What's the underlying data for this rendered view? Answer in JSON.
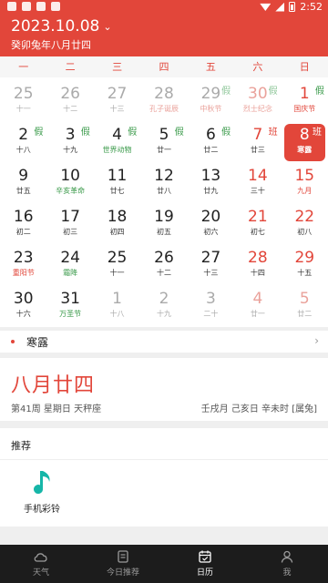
{
  "status_bar": {
    "time": "2:52"
  },
  "header": {
    "date": "2023.10.08",
    "chevron": "⌄",
    "lunar_full": "癸卯兔年八月廿四"
  },
  "weekdays": [
    "一",
    "二",
    "三",
    "四",
    "五",
    "六",
    "日"
  ],
  "days": [
    {
      "n": "25",
      "s": "十一",
      "t": "other"
    },
    {
      "n": "26",
      "s": "十二",
      "t": "other"
    },
    {
      "n": "27",
      "s": "十三",
      "t": "other"
    },
    {
      "n": "28",
      "s": "孔子诞辰",
      "t": "other festival"
    },
    {
      "n": "29",
      "s": "中秋节",
      "t": "other festival",
      "b": "假"
    },
    {
      "n": "30",
      "s": "烈士纪念",
      "t": "other weekend festival",
      "b": "假"
    },
    {
      "n": "1",
      "s": "国庆节",
      "t": "weekend festival",
      "b": "假"
    },
    {
      "n": "2",
      "s": "十八",
      "t": "",
      "b": "假"
    },
    {
      "n": "3",
      "s": "十九",
      "t": "",
      "b": "假"
    },
    {
      "n": "4",
      "s": "世界动物",
      "t": "solar",
      "b": "假"
    },
    {
      "n": "5",
      "s": "廿一",
      "t": "",
      "b": "假"
    },
    {
      "n": "6",
      "s": "廿二",
      "t": "",
      "b": "假"
    },
    {
      "n": "7",
      "s": "廿三",
      "t": "weekend",
      "b": "班",
      "bw": true
    },
    {
      "n": "8",
      "s": "寒露",
      "t": "selected",
      "b": "班",
      "bw": true
    },
    {
      "n": "9",
      "s": "廿五",
      "t": ""
    },
    {
      "n": "10",
      "s": "辛亥革命",
      "t": "solar"
    },
    {
      "n": "11",
      "s": "廿七",
      "t": ""
    },
    {
      "n": "12",
      "s": "廿八",
      "t": ""
    },
    {
      "n": "13",
      "s": "廿九",
      "t": ""
    },
    {
      "n": "14",
      "s": "三十",
      "t": "weekend"
    },
    {
      "n": "15",
      "s": "九月",
      "t": "weekend festival"
    },
    {
      "n": "16",
      "s": "初二",
      "t": ""
    },
    {
      "n": "17",
      "s": "初三",
      "t": ""
    },
    {
      "n": "18",
      "s": "初四",
      "t": ""
    },
    {
      "n": "19",
      "s": "初五",
      "t": ""
    },
    {
      "n": "20",
      "s": "初六",
      "t": ""
    },
    {
      "n": "21",
      "s": "初七",
      "t": "weekend"
    },
    {
      "n": "22",
      "s": "初八",
      "t": "weekend"
    },
    {
      "n": "23",
      "s": "重阳节",
      "t": "festival"
    },
    {
      "n": "24",
      "s": "霜降",
      "t": "solar"
    },
    {
      "n": "25",
      "s": "十一",
      "t": ""
    },
    {
      "n": "26",
      "s": "十二",
      "t": ""
    },
    {
      "n": "27",
      "s": "十三",
      "t": ""
    },
    {
      "n": "28",
      "s": "十四",
      "t": "weekend"
    },
    {
      "n": "29",
      "s": "十五",
      "t": "weekend"
    },
    {
      "n": "30",
      "s": "十六",
      "t": ""
    },
    {
      "n": "31",
      "s": "万圣节",
      "t": "solar"
    },
    {
      "n": "1",
      "s": "十八",
      "t": "other"
    },
    {
      "n": "2",
      "s": "十九",
      "t": "other"
    },
    {
      "n": "3",
      "s": "二十",
      "t": "other"
    },
    {
      "n": "4",
      "s": "廿一",
      "t": "other weekend"
    },
    {
      "n": "5",
      "s": "廿二",
      "t": "other weekend"
    }
  ],
  "solar_term_row": {
    "label": "寒露",
    "arrow": "›"
  },
  "detail": {
    "lunar": "八月廿四",
    "info_left": "第41周  星期日  天秤座",
    "info_right": "壬戌月 己亥日 辛未时 [属兔]"
  },
  "recommend": {
    "title": "推荐",
    "items": [
      {
        "label": "手机彩铃",
        "icon": "music-note-icon",
        "color": "#16b6a8"
      }
    ]
  },
  "tabs": [
    {
      "label": "天气",
      "icon": "weather-icon"
    },
    {
      "label": "今日推荐",
      "icon": "recommend-icon"
    },
    {
      "label": "日历",
      "icon": "calendar-icon",
      "active": true
    },
    {
      "label": "我",
      "icon": "profile-icon"
    }
  ],
  "colors": {
    "accent": "#e2463a",
    "green": "#3a9a4a",
    "tabbar": "#1c1c1c",
    "music": "#16b6a8"
  }
}
